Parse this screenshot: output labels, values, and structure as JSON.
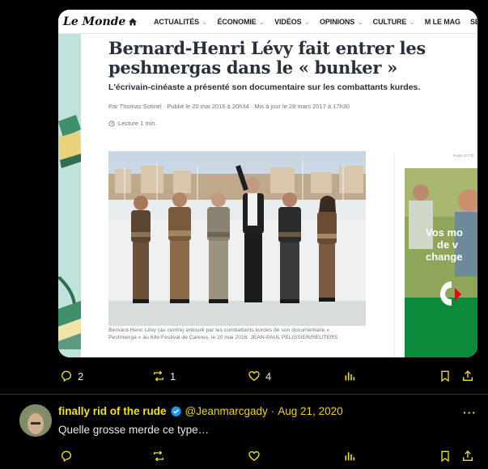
{
  "article": {
    "logo": "Le Monde",
    "nav": [
      "ACTUALITÉS",
      "ÉCONOMIE",
      "VIDÉOS",
      "OPINIONS",
      "CULTURE",
      "M LE MAG",
      "SERVICES"
    ],
    "nav_has_dropdown": [
      true,
      true,
      true,
      true,
      true,
      false,
      false
    ],
    "headline": "Bernard-Henri Lévy fait entrer les peshmergas dans le « bunker »",
    "subhead": "L'écrivain-cinéaste a présenté son documentaire sur les combattants kurdes.",
    "byline": "Par Thomas Sotinel · Publié le 20 mai 2016 à 20h34 · Mis à jour le 28 mars 2017 à 17h30",
    "read_time": "Lecture 1 min.",
    "caption": "Bernard-Henri Lévy (au centre) entouré par les combattants kurdes de son documentaire « Peshmerga » au 69e Festival de Cannes, le 20 mai 2016. JEAN-PAUL PELISSIER/REUTERS",
    "ad_label": "PUBLICITÉ",
    "ad_text_lines": [
      "Vos mo",
      "de v",
      "change"
    ]
  },
  "tweet_actions": {
    "replies": "2",
    "reposts": "1",
    "likes": "4"
  },
  "reply": {
    "name": "finally rid of the rude",
    "handle": "@Jeanmarcgady",
    "dot": "·",
    "date": "Aug 21, 2020",
    "more": "···",
    "text": "Quelle grosse merde ce type…"
  },
  "colors": {
    "accent": "#f7df1e",
    "background": "#000000",
    "verified": "#1d9bf0"
  }
}
